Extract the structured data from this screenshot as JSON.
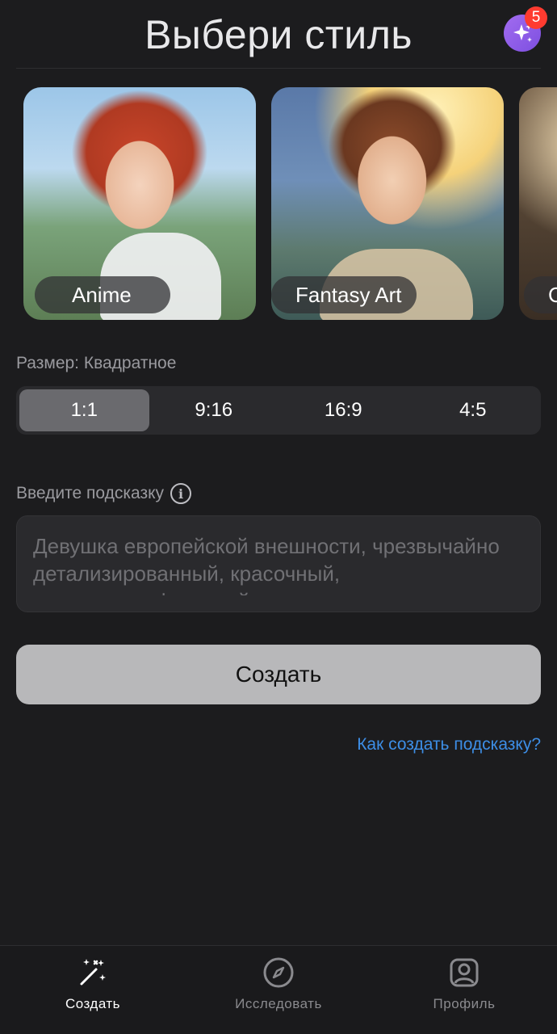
{
  "header": {
    "title": "Выбери стиль",
    "badge_count": "5"
  },
  "styles": [
    {
      "label": "Anime"
    },
    {
      "label": "Fantasy Art"
    },
    {
      "label": "C"
    }
  ],
  "size": {
    "label": "Размер: Квадратное",
    "options": [
      "1:1",
      "9:16",
      "16:9",
      "4:5"
    ],
    "selected": "1:1"
  },
  "prompt": {
    "label": "Введите подсказку",
    "placeholder": "Девушка европейской внешности, чрезвычайно детализированный, красочный, кинематографический свет"
  },
  "actions": {
    "create_label": "Создать",
    "help_link": "Как создать подсказку?"
  },
  "tabbar": {
    "items": [
      {
        "label": "Создать",
        "icon": "magic-wand-icon",
        "active": true
      },
      {
        "label": "Исследовать",
        "icon": "compass-icon",
        "active": false
      },
      {
        "label": "Профиль",
        "icon": "profile-icon",
        "active": false
      }
    ]
  },
  "colors": {
    "background": "#1c1c1e",
    "accent_link": "#3d8ee6",
    "premium": "#8f5ce8",
    "badge": "#ff3b30"
  }
}
